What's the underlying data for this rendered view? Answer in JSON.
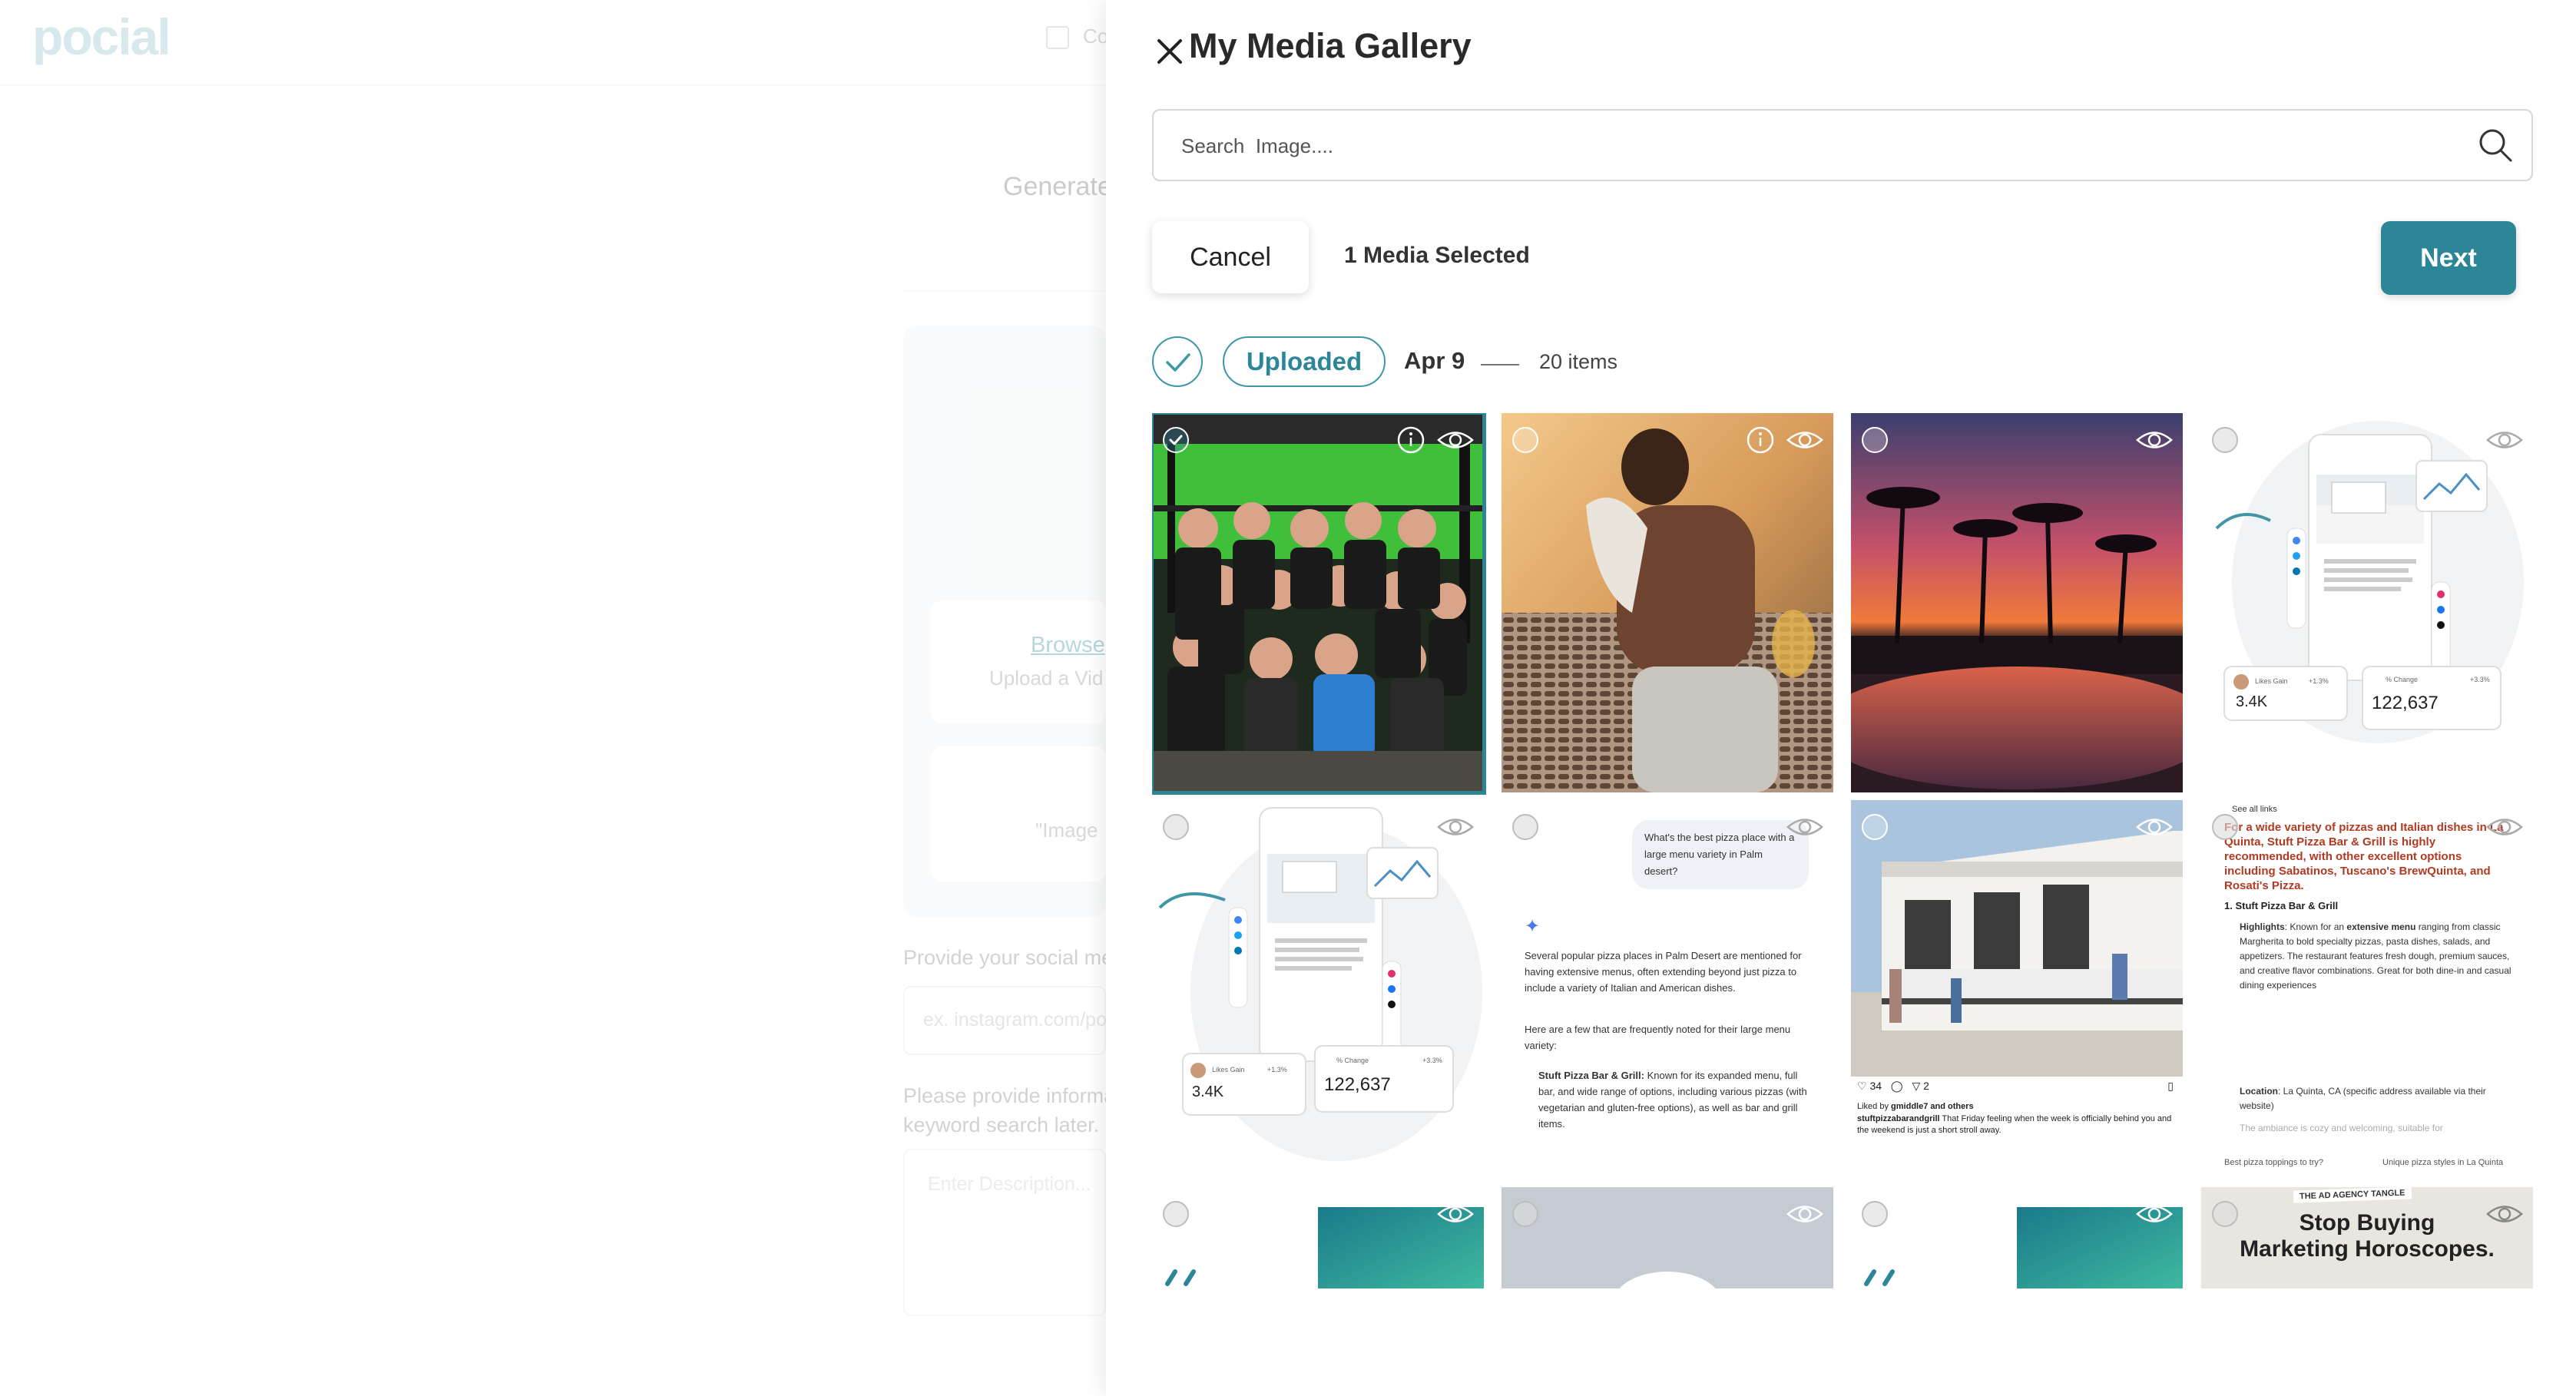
{
  "background": {
    "logo": "pocial",
    "checkbox_label": "Co",
    "heading": "Generate",
    "browse_link": "Browse",
    "upload_text": "Upload a Vid",
    "images_text": "\"Image",
    "social_label": "Provide your social me",
    "social_placeholder": "ex. instagram.com/po",
    "description_label_line1": "Please provide informa",
    "description_label_line2": "keyword search later.",
    "description_placeholder": "Enter Description..."
  },
  "panel": {
    "title": "My Media Gallery",
    "search_placeholder": "Search  Image....",
    "cancel_label": "Cancel",
    "selected_text": "1 Media Selected",
    "next_label": "Next",
    "group": {
      "tag": "Uploaded",
      "date": "Apr 9",
      "count": "20 items"
    }
  },
  "tiles": [
    {
      "id": "gym-team",
      "selected": true,
      "has_info": true
    },
    {
      "id": "runner-towel",
      "selected": false,
      "has_info": true
    },
    {
      "id": "palm-sunset",
      "selected": false,
      "has_info": false
    },
    {
      "id": "analytics-mockup-1",
      "selected": false,
      "has_info": false
    },
    {
      "id": "analytics-mockup-2",
      "selected": false,
      "has_info": false
    },
    {
      "id": "ai-pizza-chat",
      "selected": false,
      "has_info": false
    },
    {
      "id": "stuft-pizza-post",
      "selected": false,
      "has_info": false
    },
    {
      "id": "pizza-search-results",
      "selected": false,
      "has_info": false
    },
    {
      "id": "teal-graphic-1",
      "selected": false,
      "has_info": false
    },
    {
      "id": "grey-graphic",
      "selected": false,
      "has_info": false
    },
    {
      "id": "teal-graphic-2",
      "selected": false,
      "has_info": false
    },
    {
      "id": "horoscopes-ad",
      "selected": false,
      "has_info": false
    }
  ],
  "tile_text": {
    "chat_question": "What's the best pizza place with a large menu variety in Palm desert?",
    "chat_answer_1": "Several popular pizza places in Palm Desert are mentioned for having extensive menus, often extending beyond just pizza to include a variety of Italian and American dishes.",
    "chat_answer_2": "Here are a few that are frequently noted for their large menu variety:",
    "chat_bullet_title": "Stuft Pizza Bar & Grill:",
    "chat_bullet_body": "Known for its expanded menu, full bar, and wide range of options, including various pizzas (with vegetarian and gluten-free options), as well as bar and grill items.",
    "post_likes": "34",
    "post_shares": "2",
    "post_liked_by_prefix": "Liked by",
    "post_liked_by_user": "gmiddle7",
    "post_liked_by_suffix": "and others",
    "post_caption_user": "stuftpizzabarandgrill",
    "post_caption": "That Friday feeling when the week is officially behind you and the weekend is just a short stroll away.",
    "results_see_all": "See all links",
    "results_headline": "For a wide variety of pizzas and Italian dishes in La Quinta, Stuft Pizza Bar & Grill is highly recommended, with other excellent options including Sabatinos, Tuscano's BrewQuinta, and Rosati's Pizza.",
    "results_item_title": "1. Stuft Pizza Bar & Grill",
    "results_highlights_label": "Highlights",
    "results_highlights_lead": ": Known for an",
    "results_highlights_emph": "extensive menu",
    "results_highlights_body": "ranging from classic Margherita to bold specialty pizzas, pasta dishes, salads, and appetizers. The restaurant features fresh dough, premium sauces, and creative flavor combinations. Great for both dine-in and casual dining experiences",
    "results_location_label": "Location",
    "results_location_body": ": La Quinta, CA (specific address available via their website)",
    "results_faded": "The ambiance is cozy and welcoming, suitable for",
    "results_chip_1": "Best pizza toppings to try?",
    "results_chip_2": "Unique pizza styles in La Quinta",
    "mock_likes_label": "Likes Gain",
    "mock_likes_value": "3.4K",
    "mock_likes_pct": "+1.3%",
    "mock_change_label": "% Change",
    "mock_change_value": "122,637",
    "mock_change_pct": "+3.3%",
    "ad_kicker": "THE AD AGENCY TANGLE",
    "ad_headline_1": "Stop Buying",
    "ad_headline_2": "Marketing Horoscopes."
  },
  "colors": {
    "accent": "#2d8598",
    "accent_light": "#3f97a6"
  }
}
